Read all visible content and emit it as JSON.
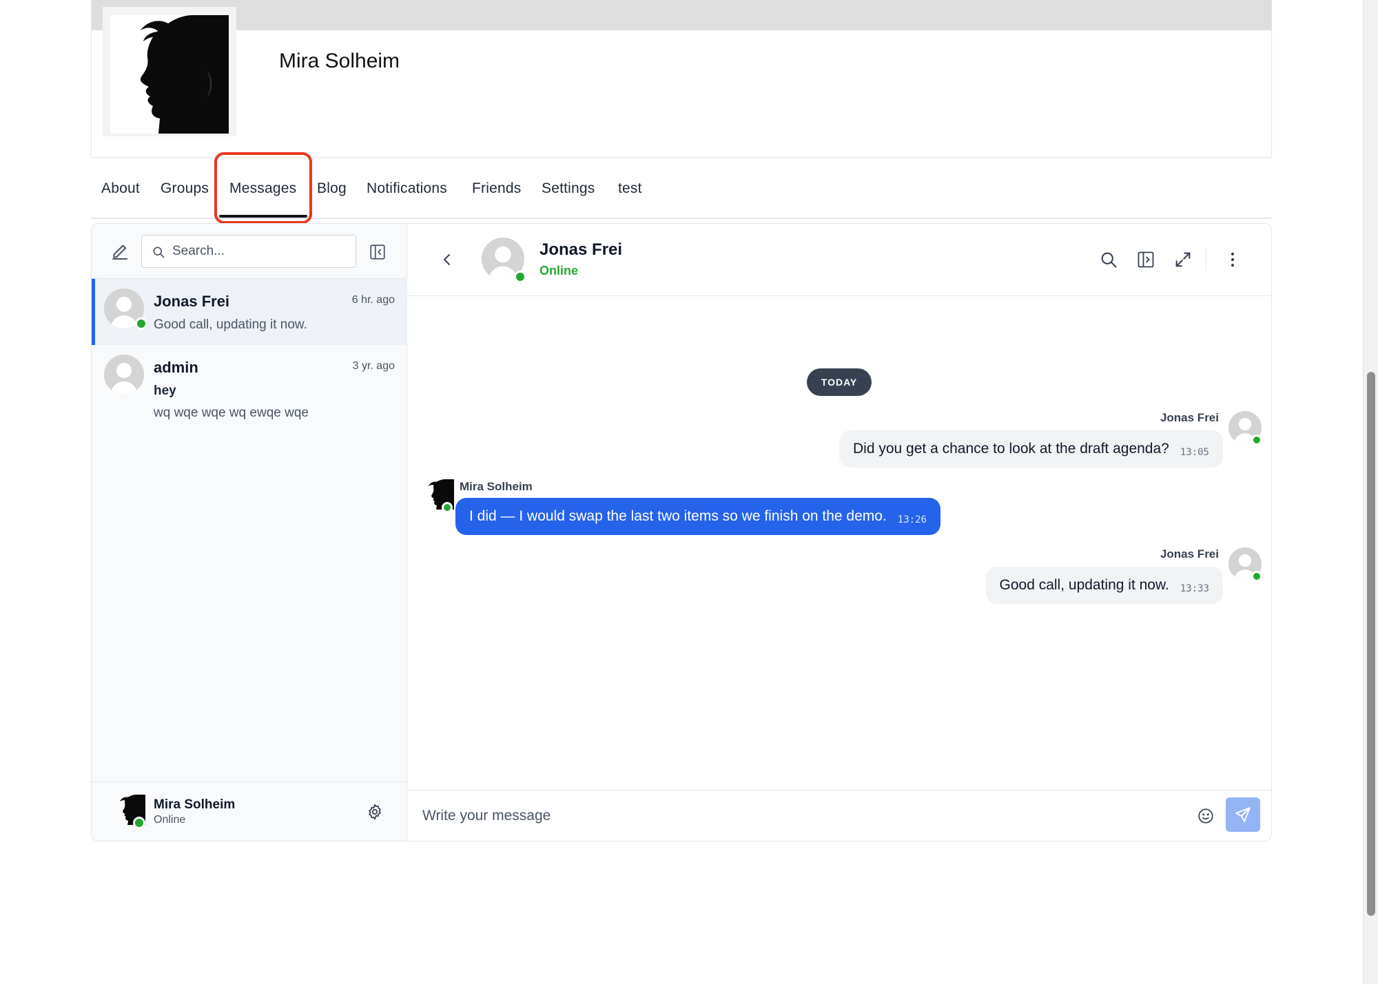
{
  "profile": {
    "name": "Mira Solheim"
  },
  "tabs": [
    {
      "label": "About"
    },
    {
      "label": "Groups"
    },
    {
      "label": "Messages",
      "active": true
    },
    {
      "label": "Blog"
    },
    {
      "label": "Notifications"
    },
    {
      "label": "Friends"
    },
    {
      "label": "Settings"
    },
    {
      "label": "test"
    }
  ],
  "sidebar": {
    "search_placeholder": "Search...",
    "conversations": [
      {
        "name": "Jonas Frei",
        "time": "6 hr. ago",
        "preview": "Good call, updating it now.",
        "online": true,
        "active": true
      },
      {
        "name": "admin",
        "time": "3 yr. ago",
        "preview_bold": "hey",
        "preview": "wq wqe wqe wq ewqe wqe",
        "online": false,
        "active": false
      }
    ],
    "footer": {
      "name": "Mira Solheim",
      "status": "Online"
    }
  },
  "chat": {
    "contact_name": "Jonas Frei",
    "contact_status": "Online",
    "day_separator": "TODAY",
    "messages": [
      {
        "sender": "Jonas Frei",
        "text": "Did you get a chance to look at the draft agenda?",
        "time": "13:05",
        "direction": "in"
      },
      {
        "sender": "Mira Solheim",
        "text": "I did — I would swap the last two items so we finish on the demo.",
        "time": "13:26",
        "direction": "out"
      },
      {
        "sender": "Jonas Frei",
        "text": "Good call, updating it now.",
        "time": "13:33",
        "direction": "in"
      }
    ],
    "composer_placeholder": "Write your message"
  },
  "colors": {
    "accent": "#2563eb",
    "online": "#22a82e",
    "highlight": "#e8391f"
  },
  "icons": [
    "compose-icon",
    "search-icon",
    "collapse-sidebar-icon",
    "settings-gear-icon",
    "chevron-left-icon",
    "search-icon",
    "panel-toggle-icon",
    "expand-icon",
    "more-vertical-icon",
    "emoji-icon",
    "send-icon"
  ]
}
